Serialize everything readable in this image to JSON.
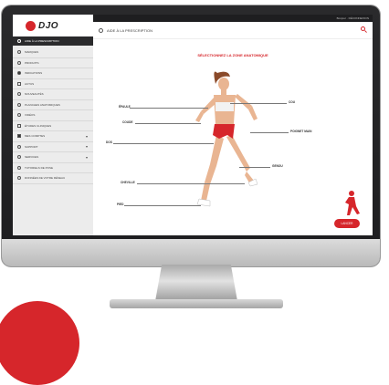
{
  "brand": {
    "logo_text": "DJO",
    "accent": "#d6262b"
  },
  "topbar": {
    "user_text": "Bonjour · DÉCONNEXION"
  },
  "sidebar": {
    "active_item": "AIDE À LA PRESCRIPTION",
    "items": [
      {
        "label": "MARQUES",
        "icon": "star-icon",
        "chevron": false
      },
      {
        "label": "PRODUITS",
        "icon": "box-icon",
        "chevron": false
      },
      {
        "label": "INDICATIONS",
        "icon": "dot-icon",
        "chevron": false
      },
      {
        "label": "ACTUS",
        "icon": "news-icon",
        "chevron": false
      },
      {
        "label": "NOUVEAUTÉS",
        "icon": "new-icon",
        "chevron": false
      },
      {
        "label": "PLANCHES ANATOMIQUES",
        "icon": "anatomy-icon",
        "chevron": false
      },
      {
        "label": "VIDÉOS",
        "icon": "video-icon",
        "chevron": false
      },
      {
        "label": "ÉTUDES CLINIQUES",
        "icon": "chart-icon",
        "chevron": false
      },
      {
        "label": "MES COMPTES",
        "icon": "account-icon",
        "chevron": true
      },
      {
        "label": "SUPPORT",
        "icon": "support-icon",
        "chevron": true
      },
      {
        "label": "SERVICES",
        "icon": "services-icon",
        "chevron": true
      },
      {
        "label": "TUTORIELS DE POSE",
        "icon": "tutorial-icon",
        "chevron": false
      },
      {
        "label": "DONNÉES DE VOTRE RÉSEAU",
        "icon": "network-icon",
        "chevron": false
      }
    ]
  },
  "header": {
    "breadcrumb": "AIDE À LA PRESCRIPTION"
  },
  "main": {
    "section_title": "SÉLECTIONNEZ LA ZONE ANATOMIQUE",
    "zones": [
      {
        "label": "ÉPAULE"
      },
      {
        "label": "COU"
      },
      {
        "label": "COUDE"
      },
      {
        "label": "POIGNET MAIN"
      },
      {
        "label": "DOS"
      },
      {
        "label": "GENOU"
      },
      {
        "label": "CHEVILLE"
      },
      {
        "label": "PIED"
      }
    ],
    "cta_label": "LANCER"
  }
}
